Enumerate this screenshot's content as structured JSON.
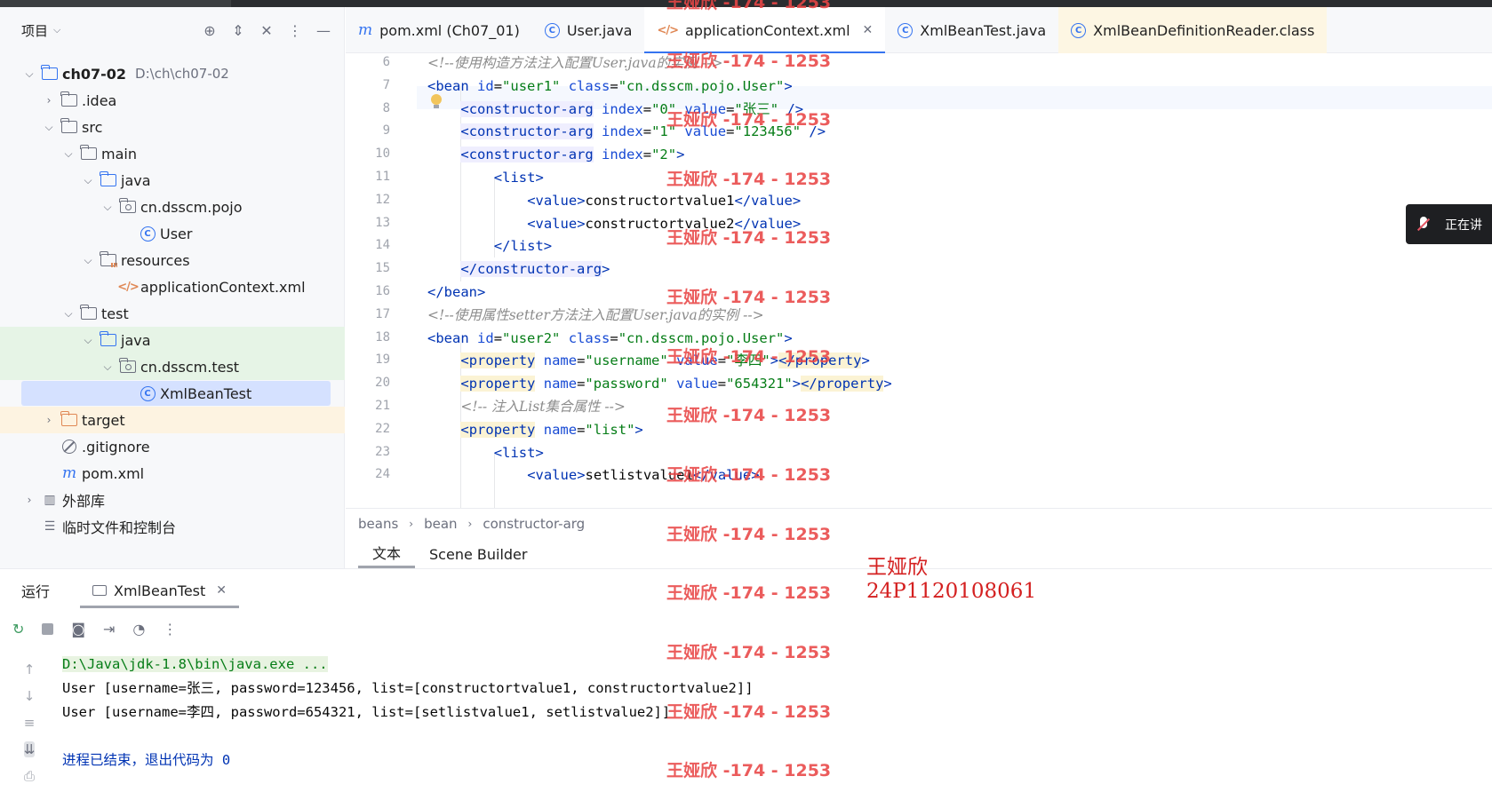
{
  "project": {
    "title": "项目",
    "tree": [
      {
        "label": "ch07-02",
        "sub": "D:\\ch\\ch07-02",
        "depth": 0,
        "arrow": "open",
        "icon": "module-icon",
        "bold": true
      },
      {
        "label": ".idea",
        "depth": 1,
        "arrow": "closed",
        "icon": "folder"
      },
      {
        "label": "src",
        "depth": 1,
        "arrow": "open",
        "icon": "folder"
      },
      {
        "label": "main",
        "depth": 2,
        "arrow": "open",
        "icon": "folder"
      },
      {
        "label": "java",
        "depth": 3,
        "arrow": "open",
        "icon": "folder-blue"
      },
      {
        "label": "cn.dsscm.pojo",
        "depth": 4,
        "arrow": "open",
        "icon": "package"
      },
      {
        "label": "User",
        "depth": 5,
        "arrow": "",
        "icon": "class"
      },
      {
        "label": "resources",
        "depth": 3,
        "arrow": "open",
        "icon": "resources"
      },
      {
        "label": "applicationContext.xml",
        "depth": 4,
        "arrow": "",
        "icon": "xml"
      },
      {
        "label": "test",
        "depth": 2,
        "arrow": "open",
        "icon": "folder"
      },
      {
        "label": "java",
        "depth": 3,
        "arrow": "open",
        "icon": "folder-green"
      },
      {
        "label": "cn.dsscm.test",
        "depth": 4,
        "arrow": "open",
        "icon": "package"
      },
      {
        "label": "XmlBeanTest",
        "depth": 5,
        "arrow": "",
        "icon": "class"
      },
      {
        "label": "target",
        "depth": 1,
        "arrow": "closed",
        "icon": "folder-orange"
      },
      {
        "label": ".gitignore",
        "depth": 1,
        "arrow": "",
        "icon": "gitignore"
      },
      {
        "label": "pom.xml",
        "depth": 1,
        "arrow": "",
        "icon": "maven"
      },
      {
        "label": "外部库",
        "depth": 0,
        "arrow": "closed",
        "icon": "libraries"
      },
      {
        "label": "临时文件和控制台",
        "depth": 0,
        "arrow": "",
        "icon": "scratches"
      }
    ]
  },
  "tabs": [
    {
      "label": "pom.xml (Ch07_01)",
      "icon": "maven"
    },
    {
      "label": "User.java",
      "icon": "class"
    },
    {
      "label": "applicationContext.xml",
      "icon": "xml",
      "active": true
    },
    {
      "label": "XmlBeanTest.java",
      "icon": "class"
    },
    {
      "label": "XmlBeanDefinitionReader.class",
      "icon": "class"
    }
  ],
  "editor": {
    "line_numbers": [
      "6",
      "7",
      "8",
      "9",
      "10",
      "11",
      "12",
      "13",
      "14",
      "15",
      "16",
      "17",
      "18",
      "19",
      "20",
      "21",
      "22",
      "23",
      "24"
    ],
    "lines": [
      "<!--使用构造方法注入配置User.java的实例 -->",
      "<bean id=\"user1\" class=\"cn.dsscm.pojo.User\">",
      "<constructor-arg index=\"0\" value=\"张三\" />",
      "<constructor-arg index=\"1\" value=\"123456\" />",
      "<constructor-arg index=\"2\">",
      "<list>",
      "<value>constructortvalue1</value>",
      "<value>constructortvalue2</value>",
      "</list>",
      "</constructor-arg>",
      "</bean>",
      "<!--使用属性setter方法注入配置User.java的实例 -->",
      "<bean id=\"user2\" class=\"cn.dsscm.pojo.User\">",
      "<property name=\"username\" value=\"李四\"></property>",
      "<property name=\"password\" value=\"654321\"></property>",
      "<!-- 注入List集合属性 -->",
      "<property name=\"list\">",
      "<list>",
      "<value>setlistvalue1</value>"
    ]
  },
  "breadcrumbs": [
    "beans",
    "bean",
    "constructor-arg"
  ],
  "editor_modes": [
    "文本",
    "Scene Builder"
  ],
  "run": {
    "title": "运行",
    "tab_label": "XmlBeanTest",
    "console": [
      "D:\\Java\\jdk-1.8\\bin\\java.exe ...",
      "User [username=张三, password=123456, list=[constructortvalue1, constructortvalue2]]",
      "User [username=李四, password=654321, list=[setlistvalue1, setlistvalue2]]",
      "",
      "进程已结束，退出代码为 0"
    ]
  },
  "float_badge": {
    "label": "正在讲"
  },
  "watermark": {
    "text": "王娅欣 -174 - 1253",
    "name": "王娅欣",
    "id": "24P1120108061"
  },
  "colors": {
    "accent": "#3574f0",
    "tag": "#0033b3",
    "attr_value": "#067d17",
    "comment": "#8c8c8c",
    "watermark": "#e84646"
  }
}
